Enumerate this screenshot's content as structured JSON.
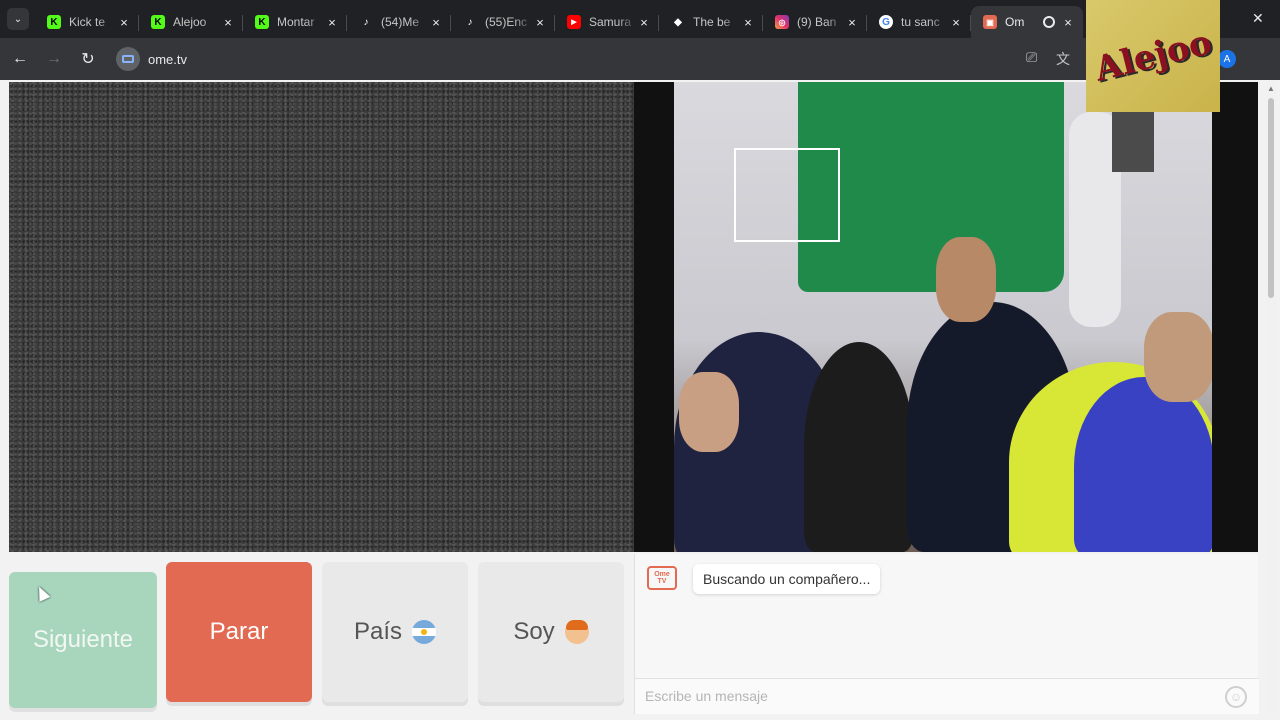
{
  "browser": {
    "tabs": [
      {
        "title": "Kick te",
        "icon": "kick-icon",
        "color": "#53fc18"
      },
      {
        "title": "Alejoo",
        "icon": "kick-icon",
        "color": "#53fc18"
      },
      {
        "title": "Montar",
        "icon": "kick-icon",
        "color": "#53fc18"
      },
      {
        "title": "(54)Me",
        "icon": "tiktok-icon",
        "color": "#ffffff"
      },
      {
        "title": "(55)Enc",
        "icon": "tiktok-icon",
        "color": "#ffffff"
      },
      {
        "title": "Samura",
        "icon": "youtube-icon",
        "color": "#ff0000"
      },
      {
        "title": "The be",
        "icon": "diamond-icon",
        "color": "#ffffff"
      },
      {
        "title": "(9) Ban",
        "icon": "instagram-icon",
        "color": "#e1306c"
      },
      {
        "title": "tu sanc",
        "icon": "google-icon",
        "color": "#4285f4"
      },
      {
        "title": "Om",
        "icon": "ometv-icon",
        "color": "#e26a52",
        "active": true
      }
    ],
    "tab_close": "×",
    "url": "ome.tv",
    "profile_initial": "A"
  },
  "overlay": {
    "art_text": "Alejoo"
  },
  "controls": {
    "next_label": "Siguiente",
    "stop_label": "Parar",
    "country_label": "País",
    "gender_label": "Soy"
  },
  "chat": {
    "logo_text": "Ome TV",
    "status_message": "Buscando un compañero...",
    "input_placeholder": "Escribe un mensaje"
  },
  "colors": {
    "stop": "#e26a52",
    "next": "#9fd3b8",
    "accent": "#e26a52"
  }
}
